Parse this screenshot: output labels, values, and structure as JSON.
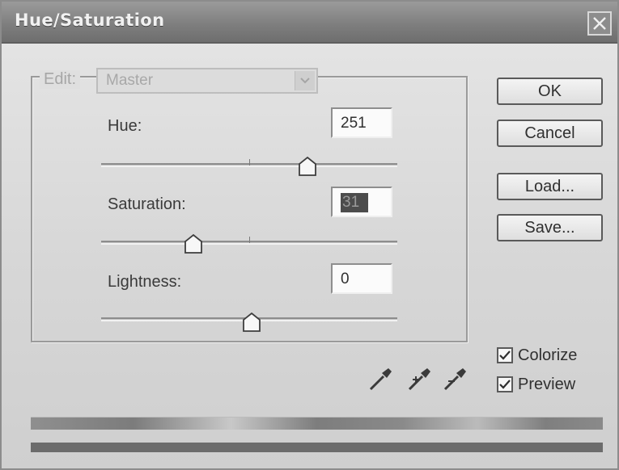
{
  "window": {
    "title": "Hue/Saturation",
    "close_icon": "close-icon"
  },
  "edit": {
    "label": "Edit:",
    "value": "Master",
    "dropdown_icon": "chevron-down-icon"
  },
  "sliders": {
    "hue": {
      "label": "Hue:",
      "value": "251",
      "range": [
        -180,
        180
      ],
      "numeric_value": 251
    },
    "saturation": {
      "label": "Saturation:",
      "value": "31",
      "range": [
        0,
        100
      ],
      "numeric_value": 31
    },
    "lightness": {
      "label": "Lightness:",
      "value": "0",
      "range": [
        -100,
        100
      ],
      "numeric_value": 0
    }
  },
  "buttons": {
    "ok": "OK",
    "cancel": "Cancel",
    "load": "Load...",
    "save": "Save..."
  },
  "checkboxes": {
    "colorize": {
      "label": "Colorize",
      "checked": true
    },
    "preview": {
      "label": "Preview",
      "checked": true
    }
  },
  "tools": {
    "eyedropper": "eyedropper-icon",
    "eyedropper_plus": "eyedropper-plus-icon",
    "eyedropper_minus": "eyedropper-minus-icon"
  }
}
